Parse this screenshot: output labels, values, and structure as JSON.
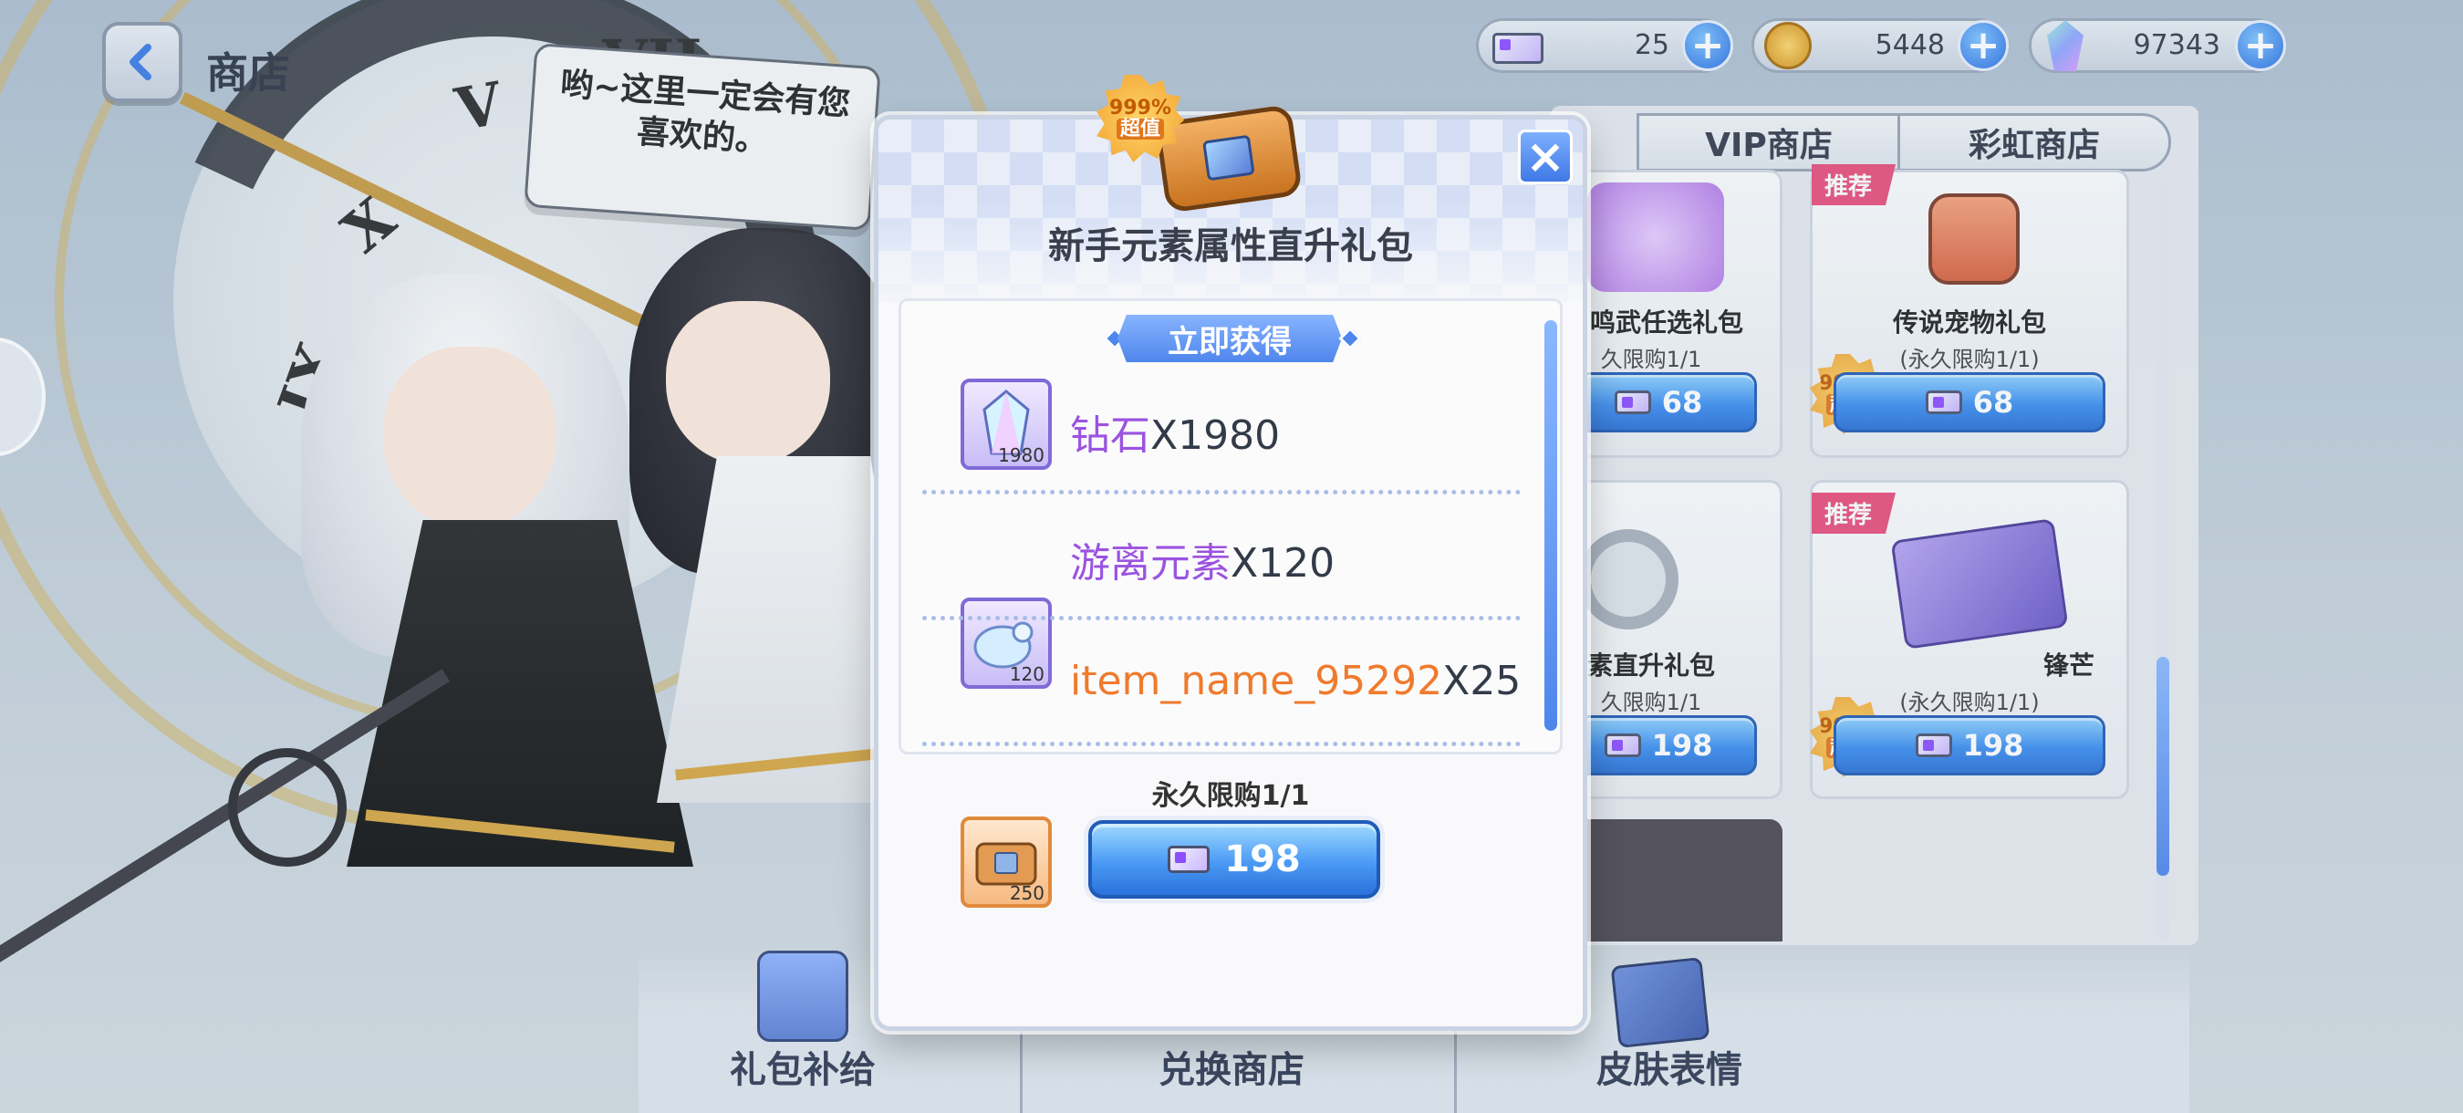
{
  "header": {
    "title": "商店"
  },
  "resources": [
    {
      "icon": "ticket-icon",
      "value": "25"
    },
    {
      "icon": "gold-coin-icon",
      "value": "5448"
    },
    {
      "icon": "crystal-icon",
      "value": "97343"
    }
  ],
  "speech": {
    "text": "哟~这里一定会有您喜欢的。"
  },
  "clock": {
    "numerals": [
      "V",
      "VII",
      "X",
      "IX"
    ]
  },
  "shop": {
    "tabs": [
      "VIP商店",
      "彩虹商店"
    ],
    "cards": [
      {
        "name": "鸣武任选礼包",
        "limit": "久限购1/1",
        "price": "68"
      },
      {
        "name": "传说宠物礼包",
        "limit": "(永久限购1/1)",
        "price": "68",
        "ribbon": "推荐",
        "badge_line1": "999%",
        "badge_line2": "超值"
      },
      {
        "name": "素直升礼包",
        "limit": "久限购1/1",
        "price": "198"
      },
      {
        "name": "锋芒",
        "limit": "(永久限购1/1)",
        "price": "198",
        "ribbon": "推荐",
        "badge_line1": "999%",
        "badge_line2": "超值"
      }
    ]
  },
  "bottom_nav": [
    "礼包补给",
    "兑换商店",
    "皮肤表情"
  ],
  "modal": {
    "badge_line1": "999%",
    "badge_line2": "超值",
    "title": "新手元素属性直升礼包",
    "section_label": "立即获得",
    "items": [
      {
        "name": "钻石",
        "qty": "X1980",
        "count": "1980",
        "icon": "diamond-crystal-icon",
        "color": "purple"
      },
      {
        "name": "游离元素",
        "qty": "X120",
        "count": "120",
        "icon": "element-blob-icon",
        "color": "purple"
      },
      {
        "name": "item_name_95292",
        "qty": "X25",
        "count": "250",
        "icon": "chest-icon",
        "color": "orange"
      }
    ],
    "limit": "永久限购1/1",
    "price": "198",
    "close_icon": "close-icon"
  }
}
